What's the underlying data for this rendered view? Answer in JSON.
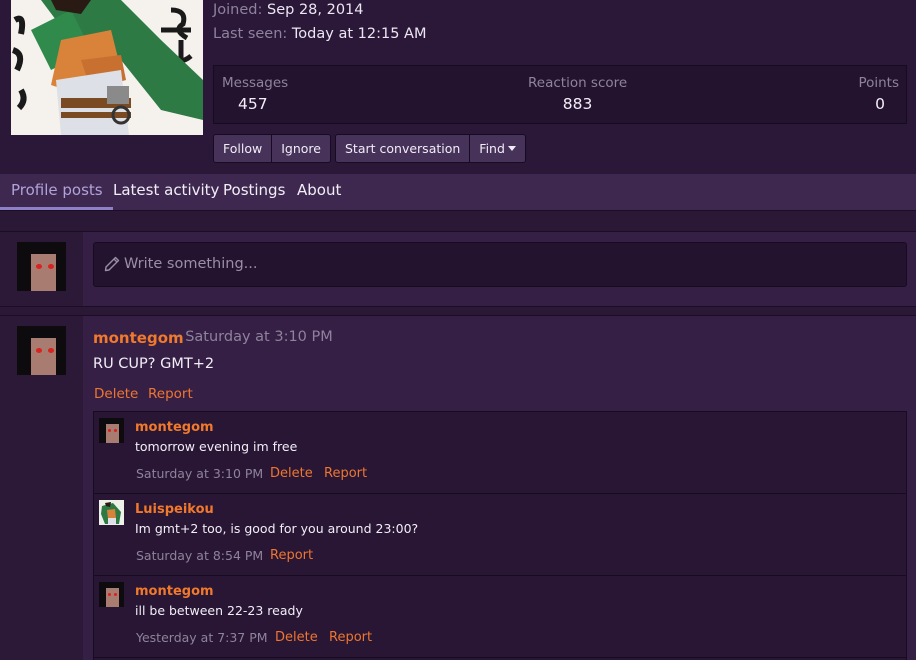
{
  "profile": {
    "joined_label": "Joined:",
    "joined_value": "Sep 28, 2014",
    "last_seen_label": "Last seen:",
    "last_seen_value": "Today at 12:15 AM",
    "stats": {
      "messages_label": "Messages",
      "messages_value": "457",
      "reaction_label": "Reaction score",
      "reaction_value": "883",
      "points_label": "Points",
      "points_value": "0"
    },
    "buttons": {
      "follow": "Follow",
      "ignore": "Ignore",
      "start_conversation": "Start conversation",
      "find": "Find"
    }
  },
  "tabs": [
    "Profile posts",
    "Latest activity",
    "Postings",
    "About"
  ],
  "composer": {
    "placeholder": "Write something..."
  },
  "post": {
    "user": "montegom",
    "time": "· Saturday at 3:10 PM",
    "body": "RU CUP? GMT+2",
    "delete": "Delete",
    "report": "Report"
  },
  "comments": [
    {
      "user": "montegom",
      "body": "tomorrow evening im free",
      "time": "Saturday at 3:10 PM",
      "delete": "Delete",
      "report": "Report"
    },
    {
      "user": "Luispeikou",
      "body": "Im gmt+2 too, is good for you around 23:00?",
      "time": "Saturday at 8:54 PM",
      "report": "Report"
    },
    {
      "user": "montegom",
      "body": "ill be between 22-23 ready",
      "time": "Yesterday at 7:37 PM",
      "delete": "Delete",
      "report": "Report"
    }
  ],
  "colors": {
    "accent_orange": "#f0792c",
    "tab_active": "#8e80c7",
    "background": "#2a1836"
  }
}
